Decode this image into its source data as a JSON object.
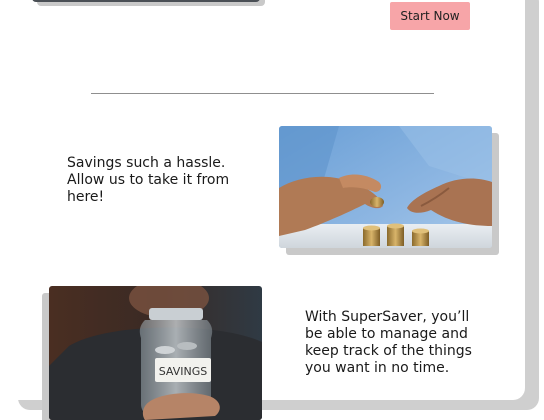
{
  "header": {
    "cta_label": "Start Now"
  },
  "features": [
    {
      "text": "Savings such a hassle. Allow us to take it from here!",
      "image": "hand-stacking-coins-photo"
    },
    {
      "text": "With SuperSaver, you’ll be able to manage and keep track of the things you want in no time.",
      "image": "savings-jar-photo",
      "image_label": "SAVINGS"
    }
  ],
  "colors": {
    "cta_background": "#f7a5a8",
    "divider": "#8f8f8f",
    "shadow": "#cfcfcf"
  }
}
